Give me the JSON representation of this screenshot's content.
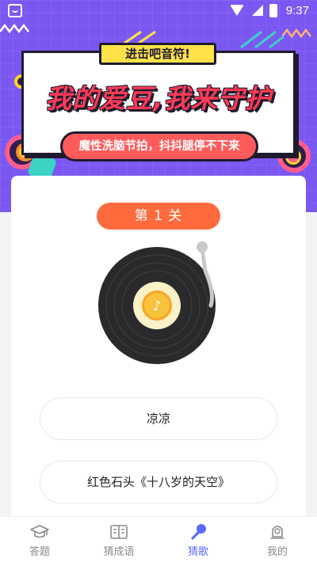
{
  "status_bar": {
    "time": "9:37"
  },
  "banner": {
    "pill": "进击吧音符!",
    "title": "我的爱豆,我来守护",
    "subtitle": "魔性洗脑节拍，抖抖腿停不下来"
  },
  "level": {
    "label": "第 1 关"
  },
  "answers": [
    {
      "text": "凉凉"
    },
    {
      "text": "红色石头《十八岁的天空》"
    }
  ],
  "bottom_nav": {
    "active": "猜歌",
    "items": [
      {
        "label": "答题",
        "icon": "graduation-cap-icon"
      },
      {
        "label": "猜成语",
        "icon": "book-icon"
      },
      {
        "label": "猜歌",
        "icon": "microphone-icon"
      },
      {
        "label": "我的",
        "icon": "user-icon"
      }
    ]
  },
  "colors": {
    "hero": "#7b57f2",
    "level_pill": "#ff6b3d",
    "banner_title": "#ff3a56",
    "nav_active": "#5b6bff"
  }
}
